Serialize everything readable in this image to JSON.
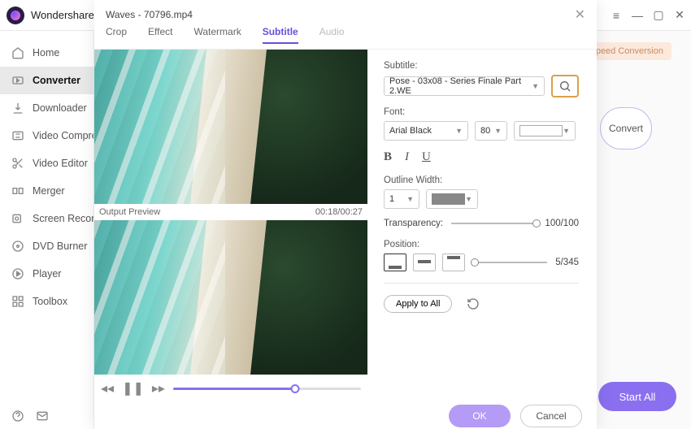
{
  "app": {
    "title": "Wondershare"
  },
  "sidebar": {
    "items": [
      {
        "label": "Home",
        "icon": "home-icon"
      },
      {
        "label": "Converter",
        "icon": "converter-icon"
      },
      {
        "label": "Downloader",
        "icon": "downloader-icon"
      },
      {
        "label": "Video Compress",
        "icon": "compress-icon"
      },
      {
        "label": "Video Editor",
        "icon": "scissors-icon"
      },
      {
        "label": "Merger",
        "icon": "merger-icon"
      },
      {
        "label": "Screen Recorder",
        "icon": "recorder-icon"
      },
      {
        "label": "DVD Burner",
        "icon": "disc-icon"
      },
      {
        "label": "Player",
        "icon": "play-icon"
      },
      {
        "label": "Toolbox",
        "icon": "grid-icon"
      }
    ]
  },
  "main": {
    "speed_label": "Speed Conversion",
    "convert_label": "Convert",
    "startall_label": "Start All"
  },
  "modal": {
    "title": "Waves - 70796.mp4",
    "tabs": [
      "Crop",
      "Effect",
      "Watermark",
      "Subtitle",
      "Audio"
    ],
    "active_tab": "Subtitle",
    "output_label": "Output Preview",
    "time": "00:18/00:27",
    "settings": {
      "subtitle_label": "Subtitle:",
      "subtitle_value": "Pose - 03x08 - Series Finale Part 2.WE",
      "font_label": "Font:",
      "font_value": "Arial Black",
      "font_size": "80",
      "outline_label": "Outline Width:",
      "outline_value": "1",
      "transparency_label": "Transparency:",
      "transparency_value": "100/100",
      "position_label": "Position:",
      "position_value": "5/345",
      "apply_label": "Apply to All"
    },
    "footer": {
      "ok": "OK",
      "cancel": "Cancel"
    }
  }
}
